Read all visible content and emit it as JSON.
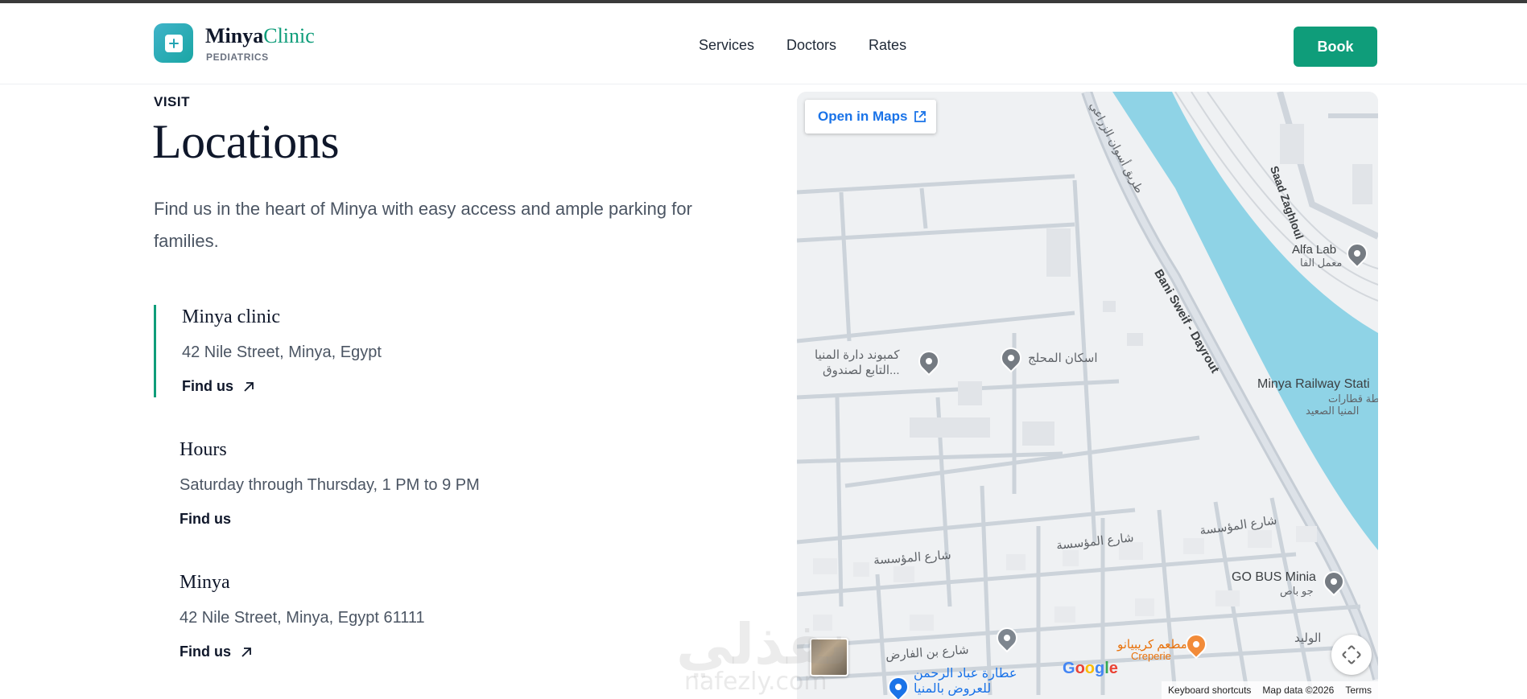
{
  "header": {
    "brand_part1": "Minya",
    "brand_part2": "Clinic",
    "brand_sub": "PEDIATRICS",
    "nav": [
      "Services",
      "Doctors",
      "Rates"
    ],
    "cta": "Book"
  },
  "section": {
    "eyebrow": "VISIT",
    "title": "Locations",
    "intro": "Find us in the heart of Minya with easy access and ample parking for families."
  },
  "locations": [
    {
      "name": "Minya clinic",
      "address": "42 Nile Street, Minya, Egypt",
      "link": "Find us"
    },
    {
      "name": "Hours",
      "address": "Saturday through Thursday, 1 PM to 9 PM",
      "link": "Find us"
    },
    {
      "name": "Minya",
      "address": "42 Nile Street, Minya, Egypt 61111",
      "link": "Find us"
    }
  ],
  "map": {
    "open_button": "Open in Maps",
    "labels": {
      "compound": "كمبوند دارة المنيا",
      "compound2": "التابع لصندوق...",
      "housing": "اسكان المحلج",
      "alfa_lab": "Alfa Lab",
      "alfa_lab_ar": "معمل الفا",
      "railway": "Minya Railway Stati",
      "railway_ar1": "محطة قطارات",
      "railway_ar2": "المنيا الصعيد",
      "saad": "Saad Zaghloul",
      "road": "Bani Sweif - Dayrout",
      "road_ar": "طريق أسوان الزراعي",
      "gobus": "GO BUS Minia",
      "gobus_ar": "جو باص",
      "street1": "شارع المؤسسة",
      "street2": "شارع المؤسسة",
      "street3": "شارع المؤسسة",
      "street4": "شارع بن الفارض",
      "street5": "الوليد",
      "creperie_ar": "مطعم كريبيانو",
      "creperie": "Creperie",
      "attara": "عطارة عباد الرحمن",
      "attara2": "للعروض بالمنيا"
    },
    "footer": [
      "Keyboard shortcuts",
      "Map data ©2026",
      "Terms"
    ],
    "google": [
      "G",
      "o",
      "o",
      "g",
      "l",
      "e"
    ]
  },
  "watermark": {
    "main": "نفذلي",
    "sub": "nafezly.com"
  }
}
